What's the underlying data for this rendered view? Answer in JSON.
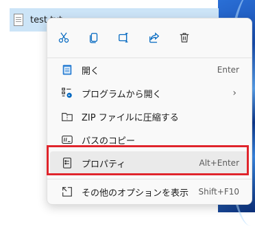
{
  "file": {
    "name": "test.txt"
  },
  "toolbar": {
    "cut_icon": "scissors-icon",
    "copy_icon": "copy-icon",
    "rename_icon": "rename-icon",
    "share_icon": "share-icon",
    "delete_icon": "trash-icon"
  },
  "menu": {
    "items": [
      {
        "label": "開く",
        "shortcut": "Enter",
        "icon": "notepad-icon"
      },
      {
        "label": "プログラムから開く",
        "shortcut": "›",
        "icon": "open-with-icon"
      },
      {
        "label": "ZIP ファイルに圧縮する",
        "shortcut": "",
        "icon": "zip-folder-icon"
      },
      {
        "label": "パスのコピー",
        "shortcut": "",
        "icon": "copy-path-icon"
      },
      {
        "label": "プロパティ",
        "shortcut": "Alt+Enter",
        "icon": "properties-icon"
      },
      {
        "label": "その他のオプションを表示",
        "shortcut": "Shift+F10",
        "icon": "more-options-icon"
      }
    ]
  },
  "colors": {
    "selection": "#cce4f7",
    "highlight_border": "#e0242b",
    "accent": "#0067c0"
  }
}
